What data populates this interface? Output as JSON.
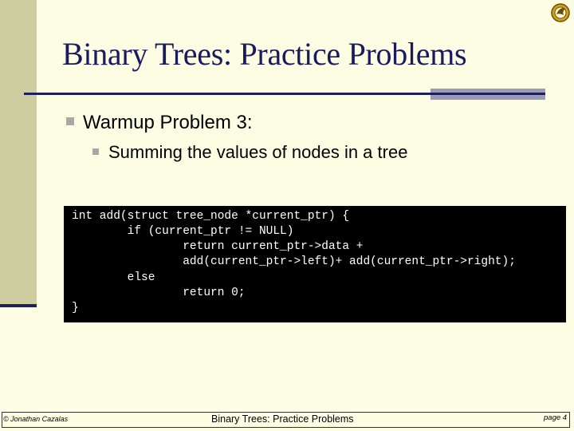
{
  "slide": {
    "title": "Binary Trees:  Practice Problems",
    "bullets": [
      {
        "text": "Warmup Problem 3:"
      },
      {
        "text": "Summing the values of nodes in a tree"
      }
    ],
    "code_lines": [
      "int add(struct tree_node *current_ptr) {",
      "        if (current_ptr != NULL)",
      "                return current_ptr->data +",
      "                add(current_ptr->left)+ add(current_ptr->right);",
      "        else",
      "                return 0;",
      "}"
    ]
  },
  "footer": {
    "author": "© Jonathan Cazalas",
    "center": "Binary Trees:  Practice Problems",
    "page": "page 4"
  },
  "colors": {
    "background": "#fdfde4",
    "title": "#1a1a5e",
    "accent_band": "#cdcda0",
    "rule": "#1f1f5f",
    "code_bg": "#000000",
    "code_fg": "#ffffff"
  },
  "icons": {
    "logo": "ucf-pegasus-logo-icon",
    "bullet": "square-bullet-icon"
  }
}
